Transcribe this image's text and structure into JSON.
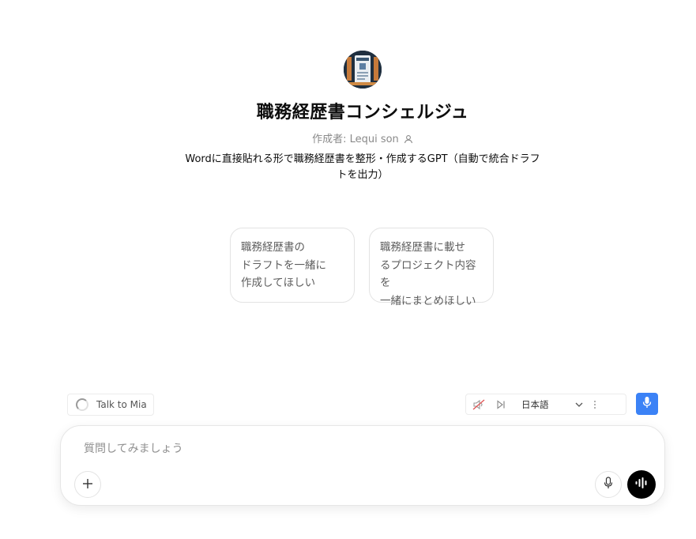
{
  "gpt": {
    "title": "職務経歴書コンシェルジュ",
    "creator_label": "作成者: Lequi son",
    "description": "Wordに直接貼れる形で職務経歴書を整形・作成するGPT（自動で統合ドラフトを出力）"
  },
  "suggestions": [
    {
      "label": "職務経歴書の\nドラフトを一緒に\n作成してほしい"
    },
    {
      "label": "職務経歴書に載せ\nるプロジェクト内容を\n一緒にまとめほしい"
    }
  ],
  "voice": {
    "talk_label": "Talk to Mia",
    "language": "日本語"
  },
  "composer": {
    "placeholder": "質問してみましょう"
  },
  "icons": {
    "creator": "person-icon",
    "mute": "speaker-muted-icon",
    "skip": "skip-next-icon",
    "chevron": "chevron-down-icon",
    "more": "more-vertical-icon",
    "mic": "microphone-icon",
    "plus": "plus-icon",
    "voice_mode": "voice-waveform-icon"
  },
  "colors": {
    "accent_blue": "#3b82f6",
    "voice_button": "#000000",
    "muted_red": "#e05252"
  }
}
